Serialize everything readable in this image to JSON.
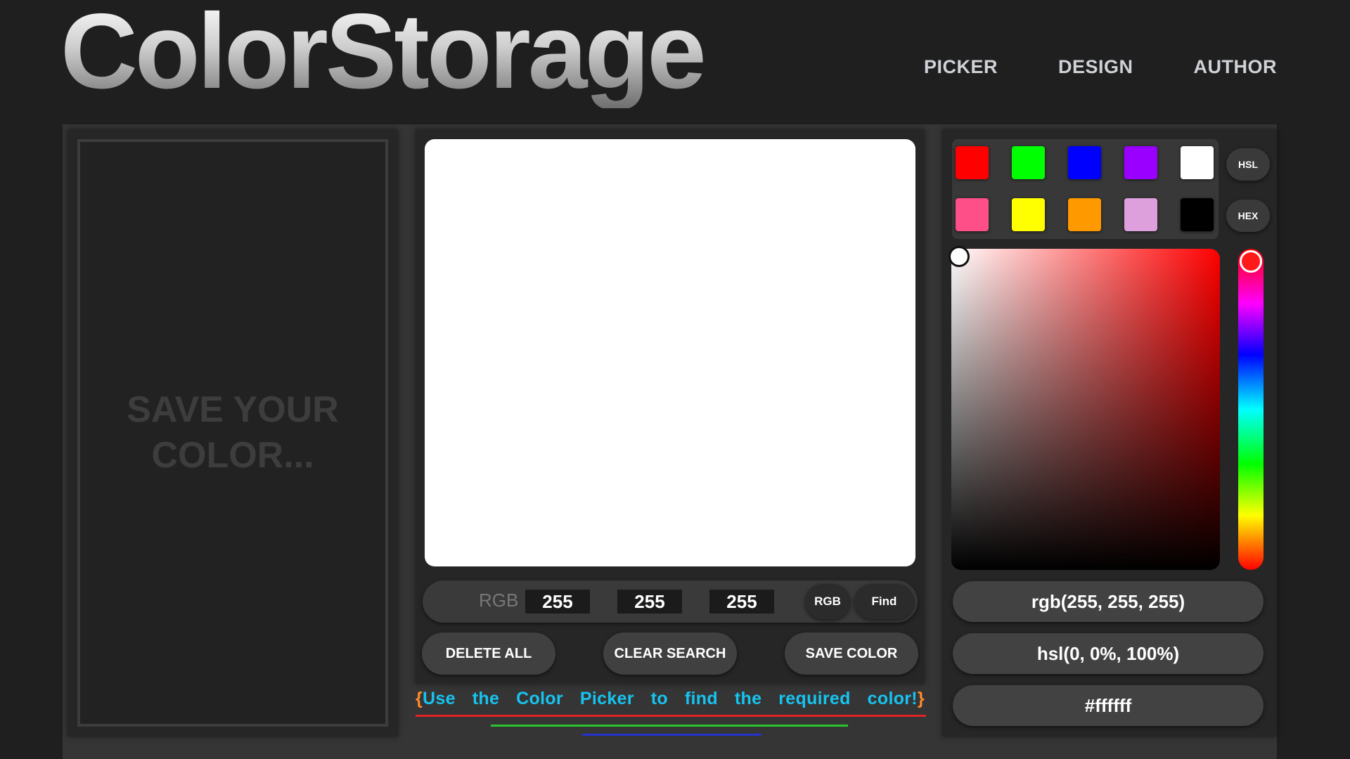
{
  "header": {
    "logo": "ColorStorage",
    "nav": [
      "PICKER",
      "DESIGN",
      "AUTHOR"
    ]
  },
  "saved": {
    "placeholder": "SAVE YOUR COLOR..."
  },
  "preview": {
    "color": "#ffffff"
  },
  "rgb": {
    "label": "RGB",
    "r": "255",
    "g": "255",
    "b": "255",
    "mode_button": "RGB",
    "find_button": "Find"
  },
  "actions": {
    "delete_all": "DELETE ALL",
    "clear_search": "CLEAR SEARCH",
    "save_color": "SAVE COLOR"
  },
  "hint": {
    "open": "{",
    "words": [
      "Use",
      "the",
      "Color",
      "Picker",
      "to",
      "find",
      "the",
      "required",
      "color!"
    ],
    "close": "}"
  },
  "swatches": {
    "row1": [
      "#ff0000",
      "#00ff00",
      "#0000ff",
      "#9900ff",
      "#ffffff"
    ],
    "row2": [
      "#ff4f88",
      "#ffff00",
      "#ff9900",
      "#dda0dd",
      "#000000"
    ]
  },
  "mode_buttons": {
    "hsl": "HSL",
    "hex": "HEX"
  },
  "picker": {
    "hue_color": "#ff0000"
  },
  "readouts": {
    "rgb": "rgb(255, 255, 255)",
    "hsl": "hsl(0, 0%, 100%)",
    "hex": "#ffffff"
  }
}
